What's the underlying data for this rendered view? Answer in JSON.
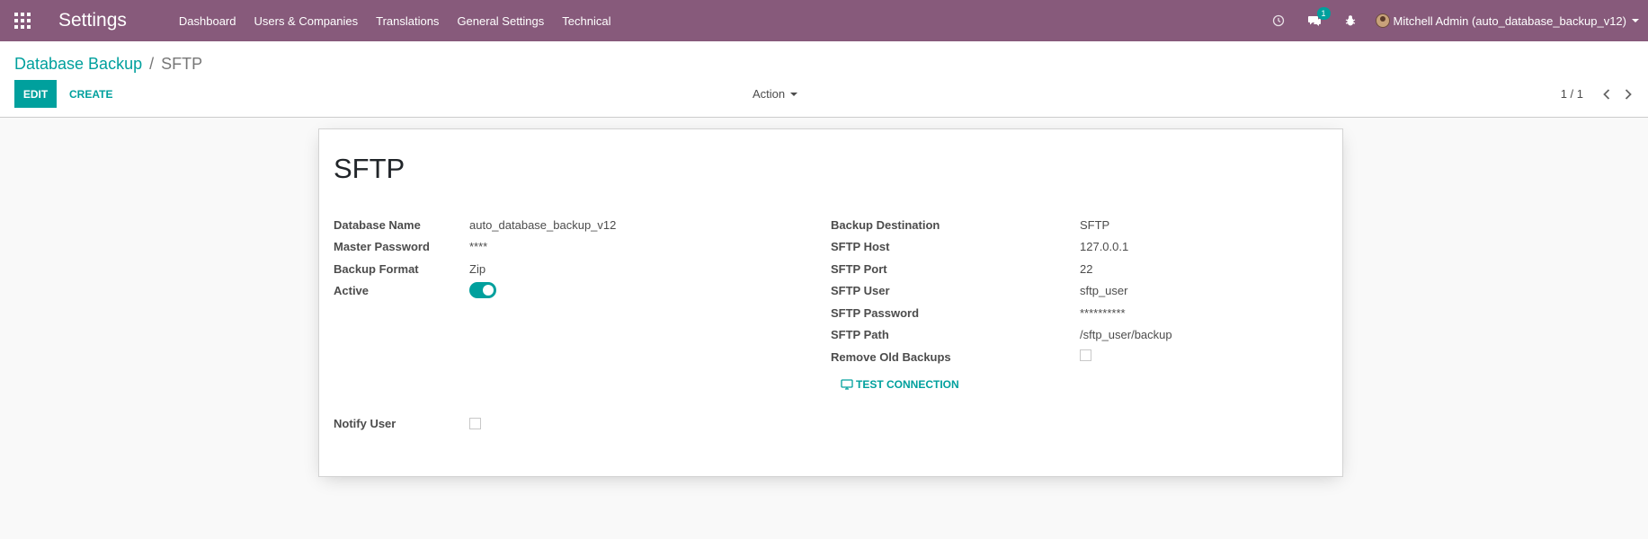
{
  "navbar": {
    "app_title": "Settings",
    "menu": [
      "Dashboard",
      "Users & Companies",
      "Translations",
      "General Settings",
      "Technical"
    ],
    "messages_count": "1",
    "user_label": "Mitchell Admin (auto_database_backup_v12)"
  },
  "breadcrumb": {
    "parent": "Database Backup",
    "separator": "/",
    "current": "SFTP"
  },
  "buttons": {
    "edit": "EDIT",
    "create": "CREATE",
    "action": "Action"
  },
  "pager": {
    "value": "1 / 1"
  },
  "form": {
    "title": "SFTP",
    "left": {
      "database_name_label": "Database Name",
      "database_name": "auto_database_backup_v12",
      "master_password_label": "Master Password",
      "master_password": "****",
      "backup_format_label": "Backup Format",
      "backup_format": "Zip",
      "active_label": "Active",
      "active": true,
      "notify_user_label": "Notify User",
      "notify_user": false
    },
    "right": {
      "backup_destination_label": "Backup Destination",
      "backup_destination": "SFTP",
      "sftp_host_label": "SFTP Host",
      "sftp_host": "127.0.0.1",
      "sftp_port_label": "SFTP Port",
      "sftp_port": "22",
      "sftp_user_label": "SFTP User",
      "sftp_user": "sftp_user",
      "sftp_password_label": "SFTP Password",
      "sftp_password": "**********",
      "sftp_path_label": "SFTP Path",
      "sftp_path": "/sftp_user/backup",
      "remove_old_backups_label": "Remove Old Backups",
      "remove_old_backups": false
    },
    "test_connection": "TEST CONNECTION"
  },
  "colors": {
    "navbar": "#875a7b",
    "accent": "#00a09d"
  }
}
